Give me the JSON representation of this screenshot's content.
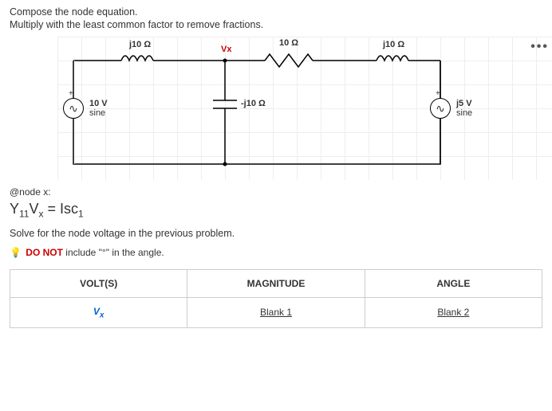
{
  "instr1": "Compose the node equation.",
  "instr2": "Multiply with the least common factor to remove fractions.",
  "circuit": {
    "z_top_left": "j10 Ω",
    "vx": "Vx",
    "z_top_mid": "10 Ω",
    "z_top_right": "j10 Ω",
    "src_left_v": "10 V",
    "src_left_type": "sine",
    "z_center": "-j10 Ω",
    "src_right_v": "j5 V",
    "src_right_type": "sine",
    "dots": "•••"
  },
  "node_label": "@node x:",
  "equation_html": "Y<sub>11</sub>V<sub>x</sub> = Isc<sub>1</sub>",
  "solve_line": "Solve for the node voltage in the previous problem.",
  "donot_prefix": "DO NOT",
  "donot_rest": " include \"°\" in the angle.",
  "table": {
    "h1": "VOLT(S)",
    "h2": "MAGNITUDE",
    "h3": "ANGLE",
    "r1": "V<sub>x</sub>",
    "r2": "Blank 1",
    "r3": "Blank 2"
  }
}
